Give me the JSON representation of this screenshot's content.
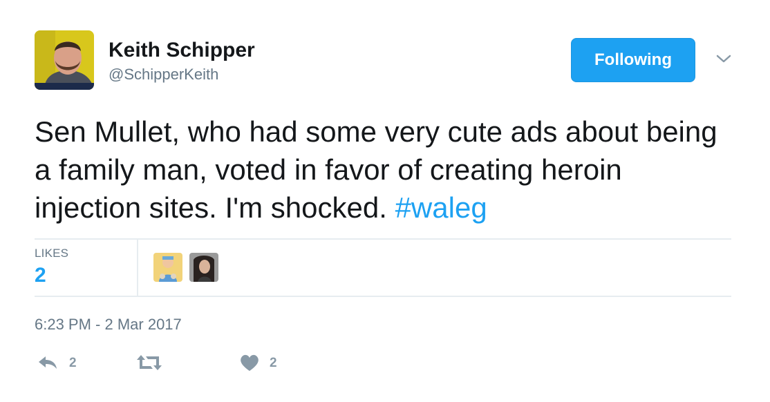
{
  "author": {
    "name": "Keith Schipper",
    "handle": "@SchipperKeith",
    "avatar_icon": "profile-photo"
  },
  "follow_button": {
    "label": "Following",
    "color": "#1da1f2"
  },
  "menu_icon": "chevron-down-icon",
  "tweet": {
    "text": "Sen Mullet, who had some very cute ads about being a family man, voted in favor of creating heroin injection sites. I'm shocked. ",
    "hashtag": "#waleg",
    "hashtag_color": "#1da1f2"
  },
  "stats": {
    "likes_label": "LIKES",
    "likes_count": "2",
    "likers": [
      "liker-avatar-1",
      "liker-avatar-2"
    ]
  },
  "timestamp": "6:23 PM - 2 Mar 2017",
  "actions": {
    "reply_count": "2",
    "retweet_count": "",
    "like_count": "2"
  }
}
